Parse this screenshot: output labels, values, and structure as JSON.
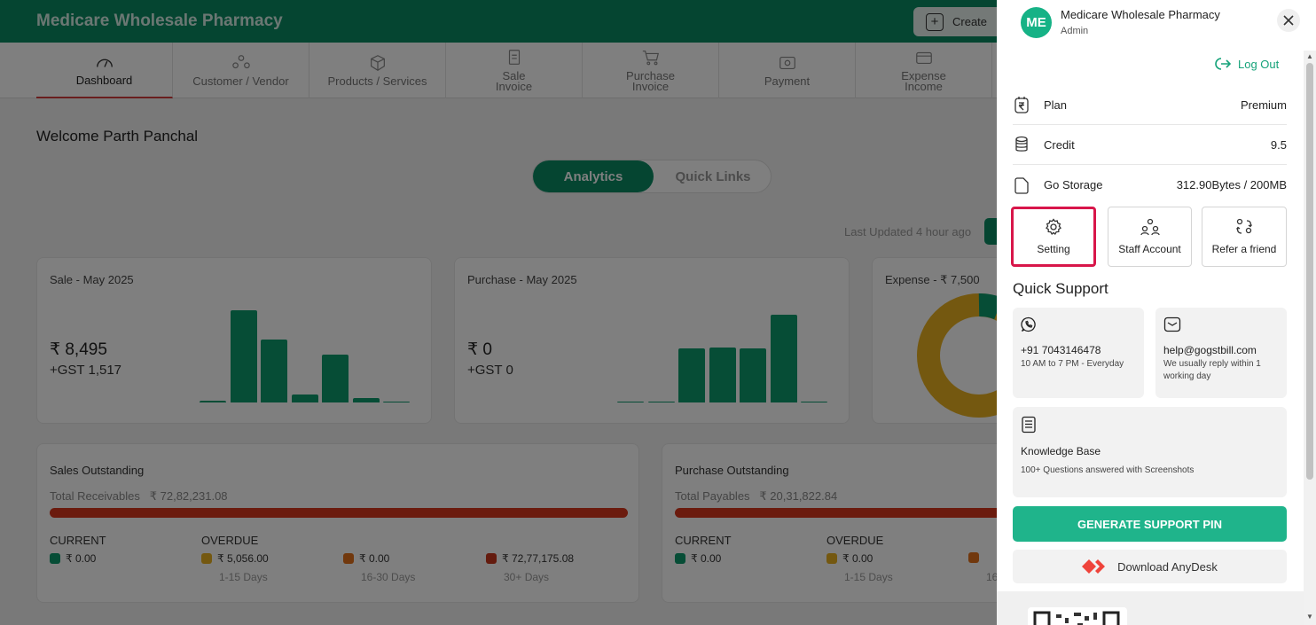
{
  "app": {
    "brand": "Medicare Wholesale Pharmacy",
    "create_label": "Create"
  },
  "nav": [
    {
      "label": "Dashboard"
    },
    {
      "label": "Customer / Vendor"
    },
    {
      "label": "Products / Services"
    },
    {
      "label": "Sale\nInvoice"
    },
    {
      "label": "Purchase\nInvoice"
    },
    {
      "label": "Payment"
    },
    {
      "label": "Expense\nIncome"
    }
  ],
  "dashboard": {
    "welcome": "Welcome Parth Panchal",
    "tab_analytics": "Analytics",
    "tab_quick_links": "Quick Links",
    "last_updated": "Last Updated 4 hour ago",
    "sale_card": {
      "title": "Sale - May 2025",
      "value": "₹ 8,495",
      "gst": "+GST 1,517"
    },
    "purchase_card": {
      "title": "Purchase - May 2025",
      "value": "₹ 0",
      "gst": "+GST 0"
    },
    "expense_card": {
      "title": "Expense - ₹ 7,500"
    },
    "sales_outstanding": {
      "title": "Sales Outstanding",
      "total_label": "Total Receivables",
      "total_value": "₹ 72,82,231.08",
      "current_label": "CURRENT",
      "overdue_label": "OVERDUE",
      "current_value": "₹ 0.00",
      "overdue": [
        {
          "value": "₹ 5,056.00",
          "range": "1-15 Days"
        },
        {
          "value": "₹ 0.00",
          "range": "16-30 Days"
        },
        {
          "value": "₹ 72,77,175.08",
          "range": "30+ Days"
        }
      ]
    },
    "purchase_outstanding": {
      "title": "Purchase Outstanding",
      "total_label": "Total Payables",
      "total_value": "₹ 20,31,822.84",
      "current_label": "CURRENT",
      "overdue_label": "OVERDUE",
      "current_value": "₹ 0.00",
      "overdue": [
        {
          "value": "₹ 0.00",
          "range": "1-15 Days"
        },
        {
          "value": "",
          "range": "16"
        }
      ]
    }
  },
  "chart_data": [
    {
      "type": "bar",
      "title": "Sale - May 2025",
      "values": [
        0.02,
        1.0,
        0.68,
        0.09,
        0.52,
        0.05,
        0.01
      ]
    },
    {
      "type": "bar",
      "title": "Purchase - May 2025",
      "values": [
        0.01,
        0.01,
        0.59,
        0.6,
        0.59,
        0.95,
        0.01
      ]
    }
  ],
  "drawer": {
    "avatar_initials": "ME",
    "org_name": "Medicare Wholesale Pharmacy",
    "role": "Admin",
    "logout_label": "Log Out",
    "plan_label": "Plan",
    "plan_value": "Premium",
    "credit_label": "Credit",
    "credit_value": "9.5",
    "storage_label": "Go Storage",
    "storage_value": "312.90Bytes / 200MB",
    "setting_label": "Setting",
    "staff_label": "Staff Account",
    "refer_label": "Refer a friend",
    "quick_support_title": "Quick Support",
    "phone": "+91 7043146478",
    "phone_hours": "10 AM to 7 PM - Everyday",
    "email": "help@gogstbill.com",
    "email_note": "We usually reply within 1 working day",
    "kb_title": "Knowledge Base",
    "kb_note": "100+ Questions answered with Screenshots",
    "generate_pin_label": "GENERATE SUPPORT PIN",
    "anydesk_label": "Download AnyDesk"
  },
  "colors": {
    "brand_green": "#0a8a63",
    "accent_teal": "#1fb48b",
    "highlight_red": "#d8164a"
  }
}
